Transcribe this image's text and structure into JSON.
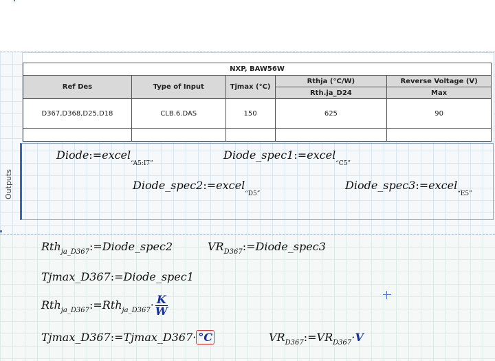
{
  "table": {
    "title": "NXP, BAW56W",
    "headers": {
      "ref_des": "Ref Des",
      "type_input": "Type of Input",
      "tjmax": "Tjmax (°C)",
      "rthja_top": "Rthja (°C/W)",
      "rthja_bottom": "Rth.ja_D24",
      "rev_top": "Reverse Voltage (V)",
      "rev_bottom": "Max"
    },
    "row": {
      "ref_des": "D367,D368,D25,D18",
      "type_input": "CLB.6.DAS",
      "tjmax": "150",
      "rthja": "625",
      "rev": "90"
    }
  },
  "outputs": {
    "label": "Outputs",
    "eq1": {
      "lhs": "Diode",
      "rhs": "excel",
      "arg": "“A5:I7”"
    },
    "eq2": {
      "lhs": "Diode_spec1",
      "rhs": "excel",
      "arg": "“C5”"
    },
    "eq3": {
      "lhs": "Diode_spec2",
      "rhs": "excel",
      "arg": "“D5”"
    },
    "eq4": {
      "lhs": "Diode_spec3",
      "rhs": "excel",
      "arg": "“E5”"
    }
  },
  "worksheet": {
    "rth_base": "Rth",
    "rth_sub": "ja_D367",
    "vr_base": "VR",
    "vr_sub": "D367",
    "spec2": "Diode_spec2",
    "spec3": "Diode_spec3",
    "tjmax_name": "Tjmax_D367",
    "spec1": "Diode_spec1",
    "unit_K": "K",
    "unit_W": "W",
    "unit_C": "°C",
    "unit_V": "V",
    "assign": ":=",
    "dot": "·"
  }
}
